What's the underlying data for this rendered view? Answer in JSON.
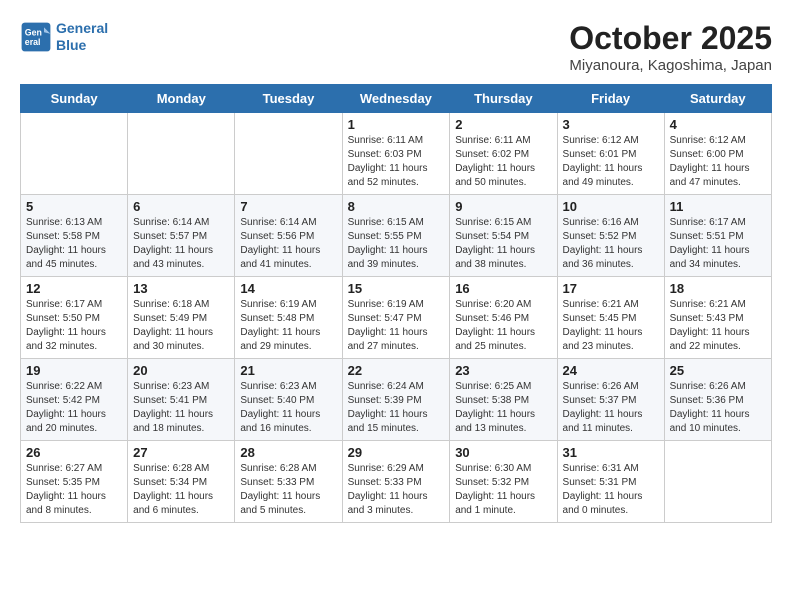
{
  "header": {
    "logo_line1": "General",
    "logo_line2": "Blue",
    "month": "October 2025",
    "location": "Miyanoura, Kagoshima, Japan"
  },
  "weekdays": [
    "Sunday",
    "Monday",
    "Tuesday",
    "Wednesday",
    "Thursday",
    "Friday",
    "Saturday"
  ],
  "weeks": [
    [
      {
        "day": "",
        "info": ""
      },
      {
        "day": "",
        "info": ""
      },
      {
        "day": "",
        "info": ""
      },
      {
        "day": "1",
        "info": "Sunrise: 6:11 AM\nSunset: 6:03 PM\nDaylight: 11 hours\nand 52 minutes."
      },
      {
        "day": "2",
        "info": "Sunrise: 6:11 AM\nSunset: 6:02 PM\nDaylight: 11 hours\nand 50 minutes."
      },
      {
        "day": "3",
        "info": "Sunrise: 6:12 AM\nSunset: 6:01 PM\nDaylight: 11 hours\nand 49 minutes."
      },
      {
        "day": "4",
        "info": "Sunrise: 6:12 AM\nSunset: 6:00 PM\nDaylight: 11 hours\nand 47 minutes."
      }
    ],
    [
      {
        "day": "5",
        "info": "Sunrise: 6:13 AM\nSunset: 5:58 PM\nDaylight: 11 hours\nand 45 minutes."
      },
      {
        "day": "6",
        "info": "Sunrise: 6:14 AM\nSunset: 5:57 PM\nDaylight: 11 hours\nand 43 minutes."
      },
      {
        "day": "7",
        "info": "Sunrise: 6:14 AM\nSunset: 5:56 PM\nDaylight: 11 hours\nand 41 minutes."
      },
      {
        "day": "8",
        "info": "Sunrise: 6:15 AM\nSunset: 5:55 PM\nDaylight: 11 hours\nand 39 minutes."
      },
      {
        "day": "9",
        "info": "Sunrise: 6:15 AM\nSunset: 5:54 PM\nDaylight: 11 hours\nand 38 minutes."
      },
      {
        "day": "10",
        "info": "Sunrise: 6:16 AM\nSunset: 5:52 PM\nDaylight: 11 hours\nand 36 minutes."
      },
      {
        "day": "11",
        "info": "Sunrise: 6:17 AM\nSunset: 5:51 PM\nDaylight: 11 hours\nand 34 minutes."
      }
    ],
    [
      {
        "day": "12",
        "info": "Sunrise: 6:17 AM\nSunset: 5:50 PM\nDaylight: 11 hours\nand 32 minutes."
      },
      {
        "day": "13",
        "info": "Sunrise: 6:18 AM\nSunset: 5:49 PM\nDaylight: 11 hours\nand 30 minutes."
      },
      {
        "day": "14",
        "info": "Sunrise: 6:19 AM\nSunset: 5:48 PM\nDaylight: 11 hours\nand 29 minutes."
      },
      {
        "day": "15",
        "info": "Sunrise: 6:19 AM\nSunset: 5:47 PM\nDaylight: 11 hours\nand 27 minutes."
      },
      {
        "day": "16",
        "info": "Sunrise: 6:20 AM\nSunset: 5:46 PM\nDaylight: 11 hours\nand 25 minutes."
      },
      {
        "day": "17",
        "info": "Sunrise: 6:21 AM\nSunset: 5:45 PM\nDaylight: 11 hours\nand 23 minutes."
      },
      {
        "day": "18",
        "info": "Sunrise: 6:21 AM\nSunset: 5:43 PM\nDaylight: 11 hours\nand 22 minutes."
      }
    ],
    [
      {
        "day": "19",
        "info": "Sunrise: 6:22 AM\nSunset: 5:42 PM\nDaylight: 11 hours\nand 20 minutes."
      },
      {
        "day": "20",
        "info": "Sunrise: 6:23 AM\nSunset: 5:41 PM\nDaylight: 11 hours\nand 18 minutes."
      },
      {
        "day": "21",
        "info": "Sunrise: 6:23 AM\nSunset: 5:40 PM\nDaylight: 11 hours\nand 16 minutes."
      },
      {
        "day": "22",
        "info": "Sunrise: 6:24 AM\nSunset: 5:39 PM\nDaylight: 11 hours\nand 15 minutes."
      },
      {
        "day": "23",
        "info": "Sunrise: 6:25 AM\nSunset: 5:38 PM\nDaylight: 11 hours\nand 13 minutes."
      },
      {
        "day": "24",
        "info": "Sunrise: 6:26 AM\nSunset: 5:37 PM\nDaylight: 11 hours\nand 11 minutes."
      },
      {
        "day": "25",
        "info": "Sunrise: 6:26 AM\nSunset: 5:36 PM\nDaylight: 11 hours\nand 10 minutes."
      }
    ],
    [
      {
        "day": "26",
        "info": "Sunrise: 6:27 AM\nSunset: 5:35 PM\nDaylight: 11 hours\nand 8 minutes."
      },
      {
        "day": "27",
        "info": "Sunrise: 6:28 AM\nSunset: 5:34 PM\nDaylight: 11 hours\nand 6 minutes."
      },
      {
        "day": "28",
        "info": "Sunrise: 6:28 AM\nSunset: 5:33 PM\nDaylight: 11 hours\nand 5 minutes."
      },
      {
        "day": "29",
        "info": "Sunrise: 6:29 AM\nSunset: 5:33 PM\nDaylight: 11 hours\nand 3 minutes."
      },
      {
        "day": "30",
        "info": "Sunrise: 6:30 AM\nSunset: 5:32 PM\nDaylight: 11 hours\nand 1 minute."
      },
      {
        "day": "31",
        "info": "Sunrise: 6:31 AM\nSunset: 5:31 PM\nDaylight: 11 hours\nand 0 minutes."
      },
      {
        "day": "",
        "info": ""
      }
    ]
  ]
}
